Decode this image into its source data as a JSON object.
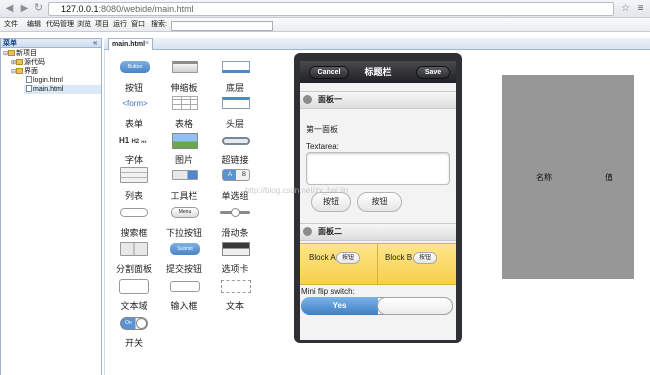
{
  "browser": {
    "url_host": "127.0.0.1",
    "url_rest": ":8080/webide/main.html"
  },
  "menubar": {
    "items": [
      "文件",
      "编辑",
      "代码管理",
      "浏览",
      "项目",
      "运行",
      "窗口",
      "搜索:"
    ],
    "search_value": ""
  },
  "left_panel": {
    "title": "菜单",
    "collapse_glyph": "«",
    "tree": [
      {
        "label": "新项目",
        "icon": "folder-icon",
        "level": 0
      },
      {
        "label": "源代码",
        "icon": "folder-icon",
        "level": 1
      },
      {
        "label": "界面",
        "icon": "folder-icon",
        "level": 1
      },
      {
        "label": "login.html",
        "icon": "page-icon",
        "level": 2
      },
      {
        "label": "main.html",
        "icon": "page-icon",
        "level": 2
      }
    ]
  },
  "editor": {
    "tab_label": "main.html",
    "tab_close": "×"
  },
  "palette": [
    {
      "label": "按钮",
      "icon": "button-icon"
    },
    {
      "label": "伸缩板",
      "icon": "accordion-icon"
    },
    {
      "label": "底层",
      "icon": "footer-icon"
    },
    {
      "label": "表单",
      "icon": "form-icon"
    },
    {
      "label": "表格",
      "icon": "grid-icon"
    },
    {
      "label": "头层",
      "icon": "header-icon"
    },
    {
      "label": "字体",
      "icon": "heading-icon"
    },
    {
      "label": "图片",
      "icon": "image-icon"
    },
    {
      "label": "超链接",
      "icon": "link-icon"
    },
    {
      "label": "列表",
      "icon": "list-icon"
    },
    {
      "label": "工具栏",
      "icon": "toolbar-icon"
    },
    {
      "label": "单选组",
      "icon": "radio-group-icon"
    },
    {
      "label": "搜索框",
      "icon": "search-field-icon"
    },
    {
      "label": "下拉按钮",
      "icon": "menu-button-icon"
    },
    {
      "label": "滑动条",
      "icon": "slider-icon"
    },
    {
      "label": "分割面板",
      "icon": "split-panel-icon"
    },
    {
      "label": "提交按钮",
      "icon": "submit-button-icon"
    },
    {
      "label": "选项卡",
      "icon": "tabs-icon"
    },
    {
      "label": "文本域",
      "icon": "textarea-icon"
    },
    {
      "label": "输入框",
      "icon": "input-icon"
    },
    {
      "label": "文本",
      "icon": "text-icon"
    },
    {
      "label": "开关",
      "icon": "toggle-icon"
    }
  ],
  "palette_icon_text": {
    "button": "Button",
    "form": "<form>",
    "heading_big": "H1",
    "heading_mid": "H2",
    "heading_small": "H3",
    "menu": "Menu",
    "submit": "Submit",
    "toggle": "On",
    "radio_a": "A",
    "radio_b": "B"
  },
  "mobile": {
    "header": {
      "left": "Cancel",
      "title": "标题栏",
      "right": "Save"
    },
    "panel1": {
      "title": "面板一",
      "text": "第一面板",
      "textarea_label": "Textarea:",
      "textarea_value": "",
      "buttons": [
        "按钮",
        "按钮"
      ]
    },
    "panel2": {
      "title": "面板二",
      "cell_a": "Block A",
      "cell_b": "Block B",
      "cell_button": "按钮"
    },
    "flip": {
      "label": "Mini flip switch:",
      "value": "Yes"
    }
  },
  "gray_box": {
    "name": "名称",
    "value": "值"
  },
  "watermark": "http://blog.csdn.net/zx_bai.lin"
}
